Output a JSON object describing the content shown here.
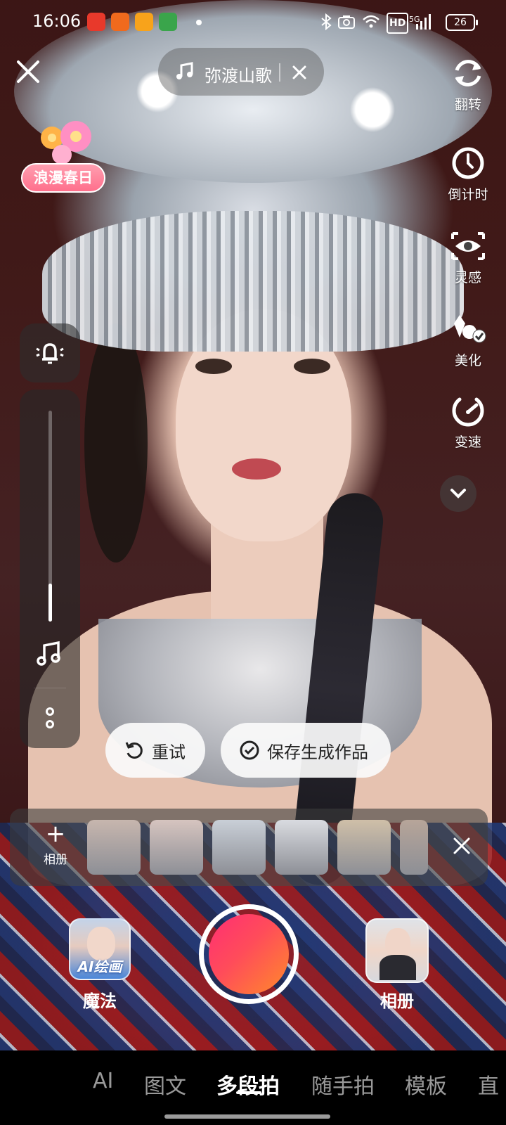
{
  "status_bar": {
    "time": "16:06",
    "app_icons": [
      "video-app-icon",
      "book-app-icon",
      "shop-app-icon",
      "play-app-icon"
    ],
    "network": "5G",
    "hd_label": "HD",
    "battery": "26"
  },
  "music": {
    "title": "弥渡山歌"
  },
  "sticker": {
    "label": "浪漫春日"
  },
  "right_toolbar": [
    {
      "id": "flip",
      "icon": "flip-camera-icon",
      "label": "翻转"
    },
    {
      "id": "countdown",
      "icon": "timer-icon",
      "label": "倒计时"
    },
    {
      "id": "inspiration",
      "icon": "inspiration-eye-icon",
      "label": "灵感"
    },
    {
      "id": "beautify",
      "icon": "beautify-icon",
      "label": "美化"
    },
    {
      "id": "speed",
      "icon": "speed-icon",
      "label": "变速"
    }
  ],
  "volume": {
    "level": 0.18
  },
  "actions": {
    "retry": "重试",
    "save": "保存生成作品"
  },
  "strip": {
    "add_label": "相册",
    "thumbs": [
      {
        "name": "thumb-1",
        "color": "#c7b6ae"
      },
      {
        "name": "thumb-2",
        "color": "#d6c4bf"
      },
      {
        "name": "thumb-3",
        "color": "#c9cfd7"
      },
      {
        "name": "thumb-4",
        "color": "#d9dbe0"
      },
      {
        "name": "thumb-5",
        "color": "#cfbfa8"
      },
      {
        "name": "thumb-6",
        "color": "#b7a599"
      }
    ]
  },
  "bottom": {
    "magic_tag": "AI绘画",
    "magic_label": "魔法",
    "album_label": "相册"
  },
  "tabs": [
    {
      "label": "AI",
      "active": false
    },
    {
      "label": "图文",
      "active": false
    },
    {
      "label": "多段拍",
      "active": true
    },
    {
      "label": "随手拍",
      "active": false
    },
    {
      "label": "模板",
      "active": false
    },
    {
      "label": "直",
      "active": false
    }
  ],
  "colors": {
    "shutter_start": "#ff2e74",
    "shutter_end": "#ff8a2a",
    "sticker_pink": "#ff6f8c"
  }
}
